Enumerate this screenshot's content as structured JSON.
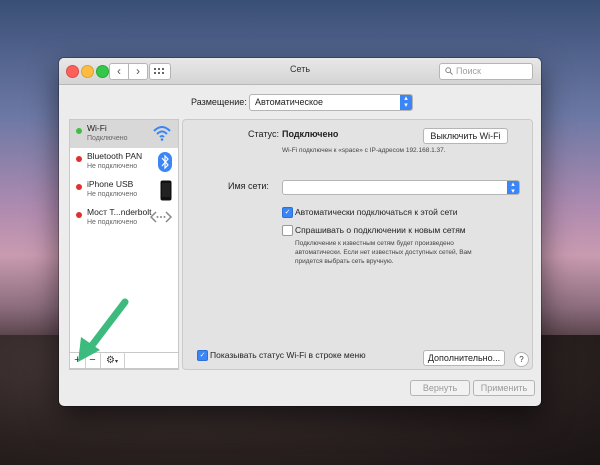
{
  "window": {
    "title": "Сеть"
  },
  "search": {
    "placeholder": "Поиск"
  },
  "location": {
    "label": "Размещение:",
    "value": "Автоматическое"
  },
  "services": [
    {
      "name": "Wi-Fi",
      "status": "Подключено",
      "color": "#3fbf3f",
      "icon": "wifi-icon"
    },
    {
      "name": "Bluetooth PAN",
      "status": "Не подключено",
      "color": "#e03030",
      "icon": "bluetooth-icon"
    },
    {
      "name": "iPhone USB",
      "status": "Не подключено",
      "color": "#e03030",
      "icon": "iphone-icon"
    },
    {
      "name": "Мост T...nderbolt",
      "status": "Не подключено",
      "color": "#e03030",
      "icon": "bridge-icon"
    }
  ],
  "toolbar": {
    "add": "+",
    "remove": "−"
  },
  "detail": {
    "status_label": "Статус:",
    "status_value": "Подключено",
    "turn_off_button": "Выключить Wi-Fi",
    "status_note": "Wi-Fi подключен к «space» с IP-адресом 192.168.1.37.",
    "network_name_label": "Имя сети:",
    "auto_join_label": "Автоматически подключаться к этой сети",
    "auto_join_checked": true,
    "ask_join_label": "Спрашивать о подключении к новым сетям",
    "ask_join_checked": false,
    "ask_note_1": "Подключение к известным сетям будет произведено",
    "ask_note_2": "автоматически. Если нет известных доступных сетей, Вам",
    "ask_note_3": "придется выбрать сеть вручную.",
    "show_status_label": "Показывать статус Wi-Fi в строке меню",
    "show_status_checked": true,
    "advanced_button": "Дополнительно...",
    "help_button": "?"
  },
  "footer": {
    "revert_button": "Вернуть",
    "apply_button": "Применить"
  },
  "colors": {
    "accent": "#3b86f7",
    "annotation_arrow": "#3dbb7e"
  }
}
